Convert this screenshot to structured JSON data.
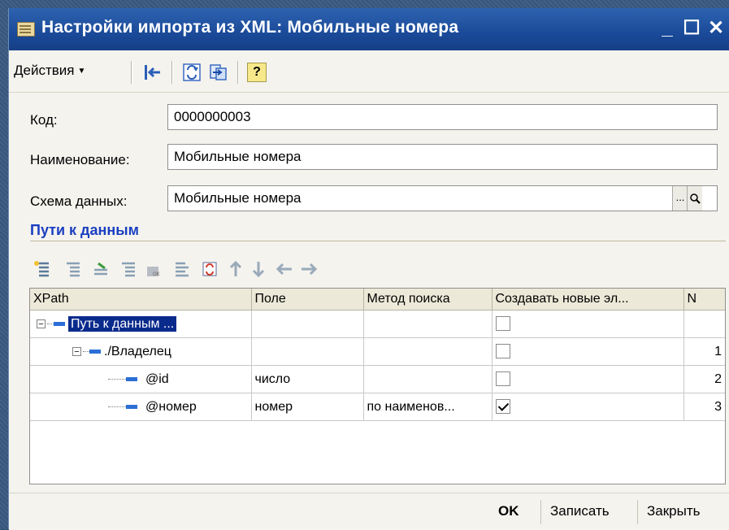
{
  "window": {
    "title": "Настройки импорта из XML: Мобильные номера",
    "min_glyph": "_",
    "max_glyph": "☐",
    "close_glyph": "✕"
  },
  "toolbar": {
    "actions_label": "Действия",
    "help_glyph": "?"
  },
  "form": {
    "code_label": "Код:",
    "code_value": "0000000003",
    "name_label": "Наименование:",
    "name_value": "Мобильные номера",
    "schema_label": "Схема данных:",
    "schema_value": "Мобильные номера",
    "schema_select_glyph": "...",
    "schema_open_glyph": "🔍"
  },
  "paths_section": {
    "title": "Пути к данным"
  },
  "grid": {
    "columns": [
      "XPath",
      "Поле",
      "Метод поиска",
      "Создавать новые эл...",
      "N"
    ],
    "rows": [
      {
        "xpath": "Путь к данным ...",
        "field": "",
        "method": "",
        "create": false,
        "n": "",
        "level": 0,
        "expander": "−",
        "selected": true
      },
      {
        "xpath": "./Владелец",
        "field": "",
        "method": "",
        "create": false,
        "n": "1",
        "level": 1,
        "expander": "−",
        "selected": false
      },
      {
        "xpath": "@id",
        "field": "число",
        "method": "",
        "create": false,
        "n": "2",
        "level": 2,
        "expander": "",
        "selected": false
      },
      {
        "xpath": "@номер",
        "field": "номер",
        "method": "по наименов...",
        "create": true,
        "n": "3",
        "level": 2,
        "expander": "",
        "selected": false
      }
    ]
  },
  "bottom": {
    "ok_label": "OK",
    "save_label": "Записать",
    "close_label": "Закрыть"
  },
  "colors": {
    "title_bar": "#1a4a99",
    "section_title": "#1a3fc0",
    "selection": "#0a2a8c"
  }
}
